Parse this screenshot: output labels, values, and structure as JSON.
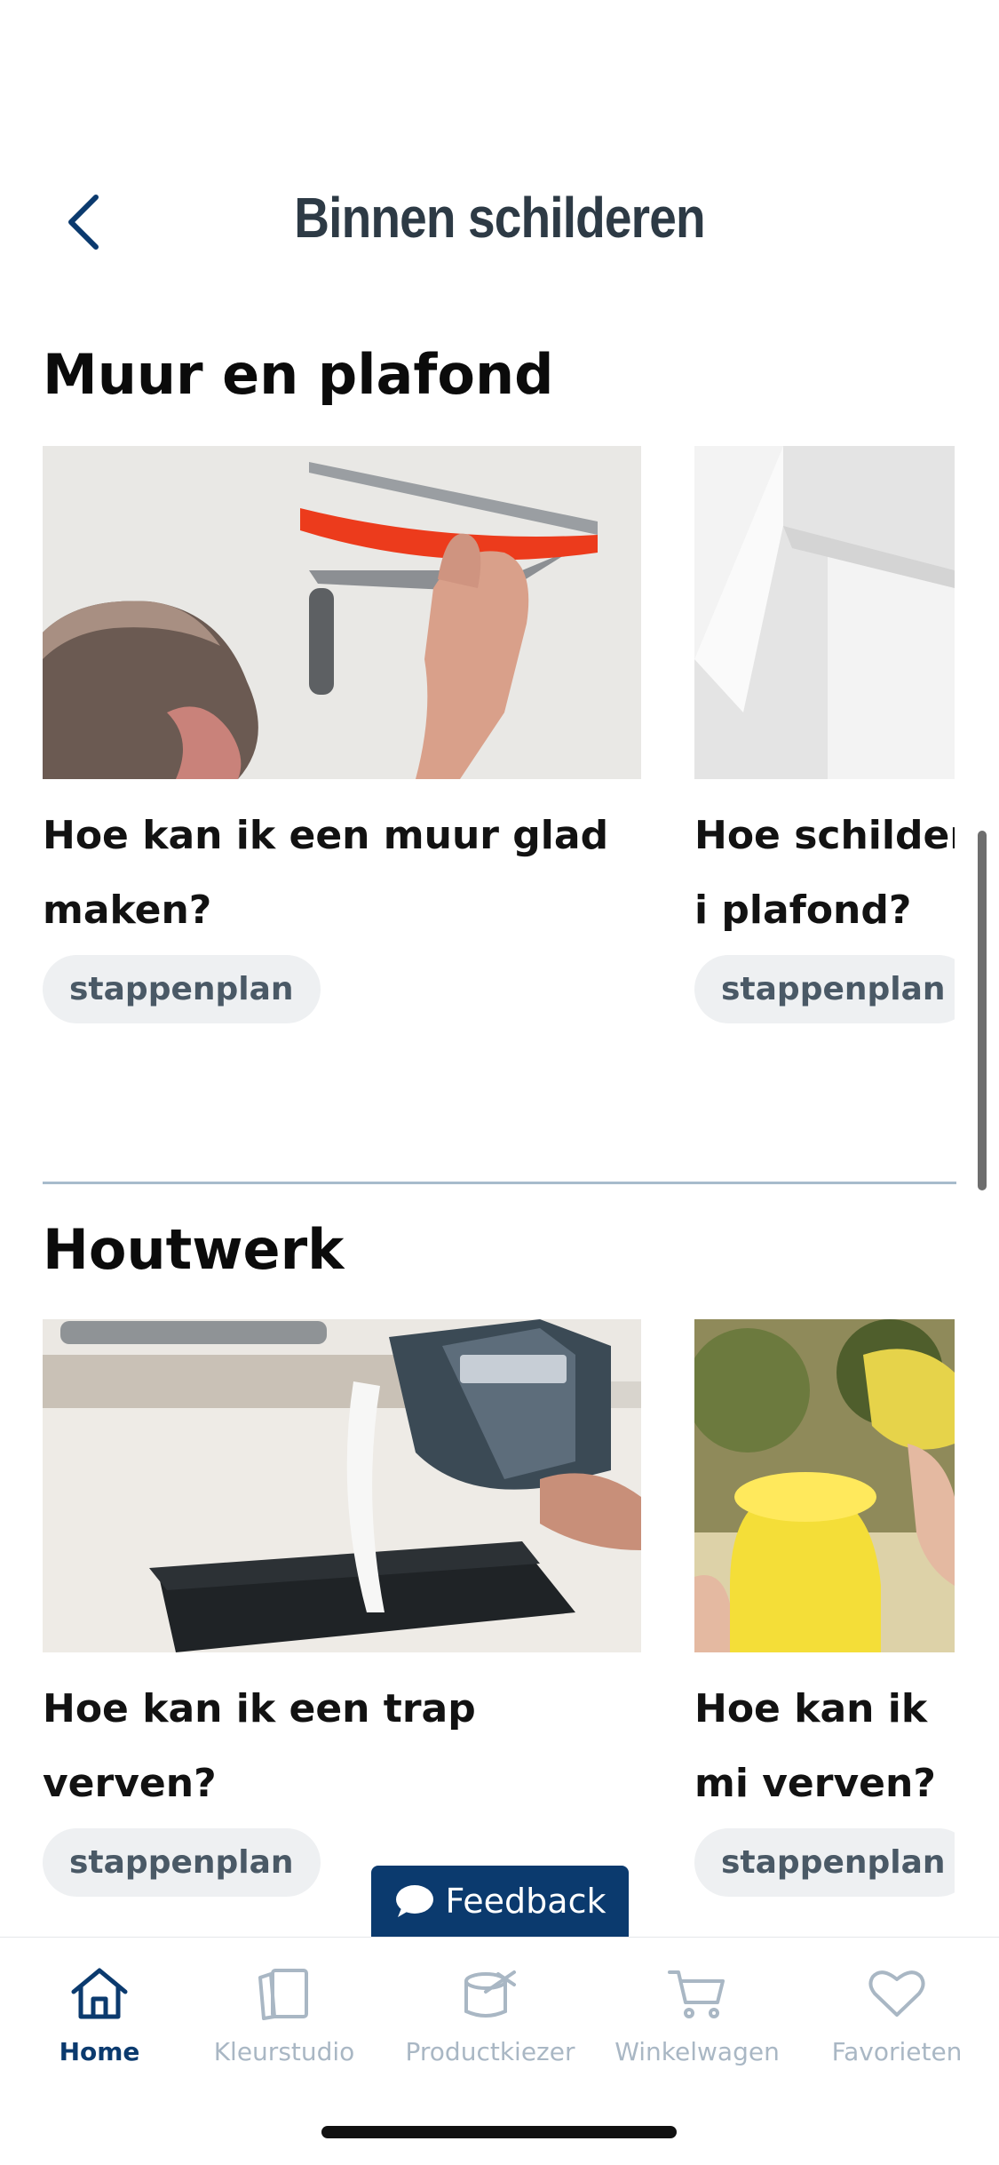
{
  "header": {
    "title": "Binnen schilderen"
  },
  "sections": [
    {
      "title": "Muur en plafond",
      "cards": [
        {
          "title": "Hoe kan ik een muur glad maken?",
          "tag": "stappenplan"
        },
        {
          "title": "Hoe schilder i plafond?",
          "tag": "stappenplan"
        }
      ]
    },
    {
      "title": "Houtwerk",
      "cards": [
        {
          "title": "Hoe kan ik een trap verven?",
          "tag": "stappenplan"
        },
        {
          "title": "Hoe kan ik mi verven?",
          "tag": "stappenplan"
        }
      ]
    }
  ],
  "feedback": {
    "label": "Feedback"
  },
  "tabbar": {
    "items": [
      {
        "label": "Home",
        "icon": "home-icon"
      },
      {
        "label": "Kleurstudio",
        "icon": "color-swatch-icon"
      },
      {
        "label": "Productkiezer",
        "icon": "paint-can-icon"
      },
      {
        "label": "Winkelwagen",
        "icon": "cart-icon"
      },
      {
        "label": "Favorieten",
        "icon": "heart-icon"
      }
    ]
  },
  "colors": {
    "brand": "#0b3a6e",
    "title": "#2d3a45",
    "tag_bg": "#eef0f2",
    "tab_inactive": "#a9b7c4",
    "accent_orange": "#ec3b1c"
  }
}
